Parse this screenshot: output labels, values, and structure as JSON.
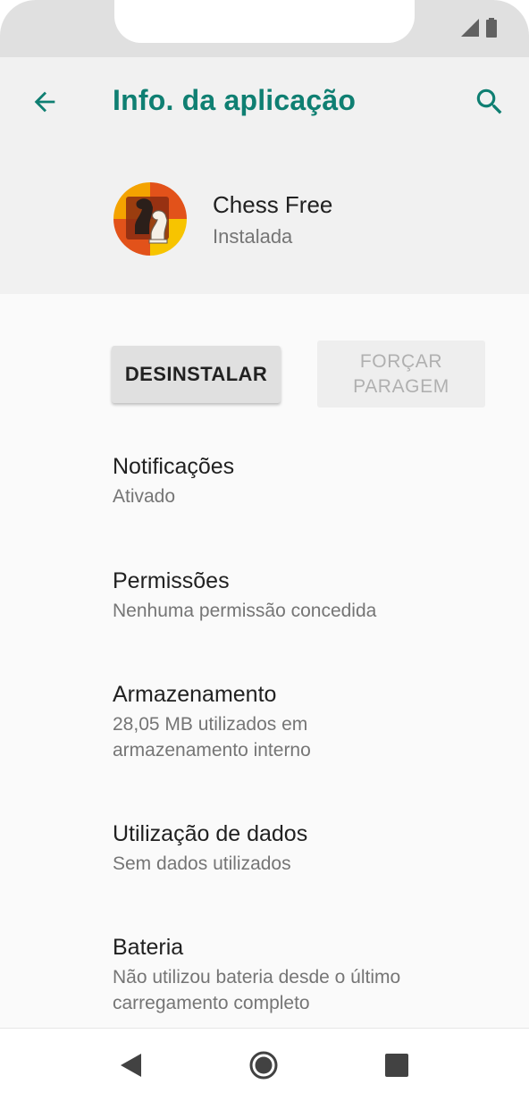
{
  "header": {
    "title": "Info. da aplicação",
    "back_icon": "arrow-back-icon",
    "search_icon": "search-icon"
  },
  "app": {
    "name": "Chess Free",
    "status": "Instalada"
  },
  "buttons": {
    "uninstall": "DESINSTALAR",
    "force_stop_line1": "FORÇAR",
    "force_stop_line2": "PARAGEM"
  },
  "settings": [
    {
      "label": "Notificações",
      "sub": "Ativado"
    },
    {
      "label": "Permissões",
      "sub": "Nenhuma permissão concedida"
    },
    {
      "label": "Armazenamento",
      "sub_line1": "28,05 MB utilizados em",
      "sub_line2": "armazenamento interno"
    },
    {
      "label": "Utilização de dados",
      "sub": "Sem dados utilizados"
    },
    {
      "label": "Bateria",
      "sub_line1": "Não utilizou bateria desde o último",
      "sub_line2": "carregamento completo"
    }
  ],
  "colors": {
    "accent": "#0f7f72",
    "header_bg": "#f1f1f1",
    "page_bg": "#fafafa"
  }
}
